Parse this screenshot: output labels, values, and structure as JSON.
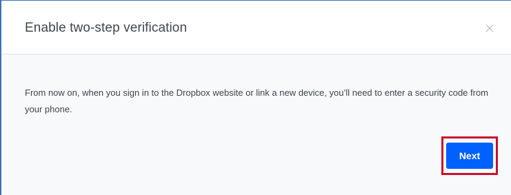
{
  "dialog": {
    "title": "Enable two-step verification",
    "close_icon": "close-icon",
    "body_text": "From now on, when you sign in to the Dropbox website or link a new device, you’ll need to enter a security code from your phone.",
    "next_label": "Next"
  },
  "colors": {
    "accent": "#0061fe",
    "highlight": "#c8102e",
    "window_border": "#3d6fb6"
  }
}
